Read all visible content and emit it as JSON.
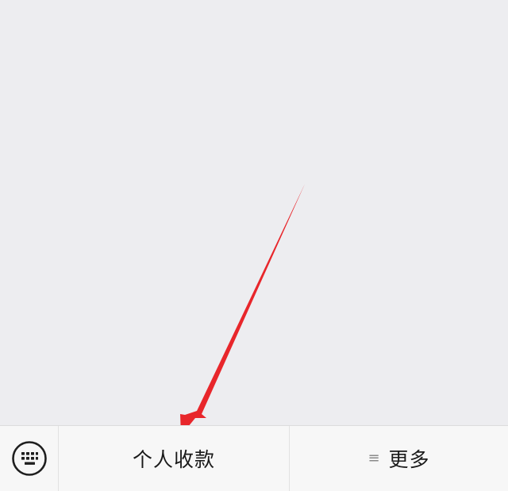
{
  "menu": {
    "keyboard_toggle_icon": "keyboard-icon",
    "item1_label": "个人收款",
    "item2_label": "更多",
    "item2_icon_glyph": "≡",
    "item2_icon": "menu-lines-icon"
  },
  "colors": {
    "annotation_arrow": "#e8262b",
    "chat_background": "#ededf0",
    "menu_background": "#f7f7f7"
  }
}
